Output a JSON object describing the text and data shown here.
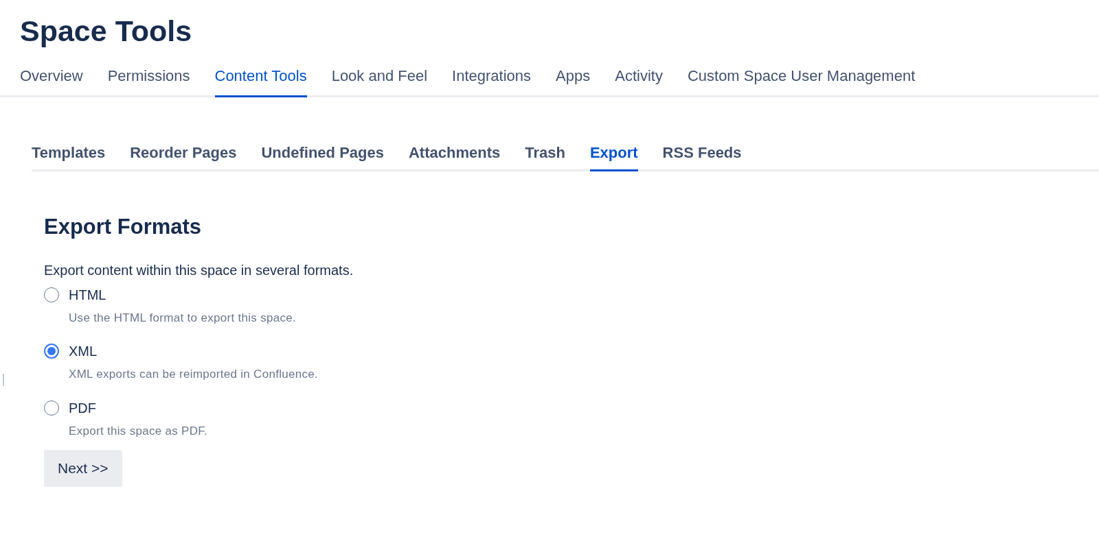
{
  "page_title": "Space Tools",
  "tabs": [
    {
      "label": "Overview",
      "selected": false
    },
    {
      "label": "Permissions",
      "selected": false
    },
    {
      "label": "Content Tools",
      "selected": true
    },
    {
      "label": "Look and Feel",
      "selected": false
    },
    {
      "label": "Integrations",
      "selected": false
    },
    {
      "label": "Apps",
      "selected": false
    },
    {
      "label": "Activity",
      "selected": false
    },
    {
      "label": "Custom Space User Management",
      "selected": false
    }
  ],
  "subtabs": [
    {
      "label": "Templates",
      "selected": false
    },
    {
      "label": "Reorder Pages",
      "selected": false
    },
    {
      "label": "Undefined Pages",
      "selected": false
    },
    {
      "label": "Attachments",
      "selected": false
    },
    {
      "label": "Trash",
      "selected": false
    },
    {
      "label": "Export",
      "selected": true
    },
    {
      "label": "RSS Feeds",
      "selected": false
    }
  ],
  "section": {
    "heading": "Export Formats",
    "description": "Export content within this space in several formats.",
    "options": [
      {
        "label": "HTML",
        "hint": "Use the HTML format to export this space.",
        "selected": false
      },
      {
        "label": "XML",
        "hint": "XML exports can be reimported in Confluence.",
        "selected": true
      },
      {
        "label": "PDF",
        "hint": "Export this space as PDF.",
        "selected": false
      }
    ],
    "button": "Next >>"
  }
}
